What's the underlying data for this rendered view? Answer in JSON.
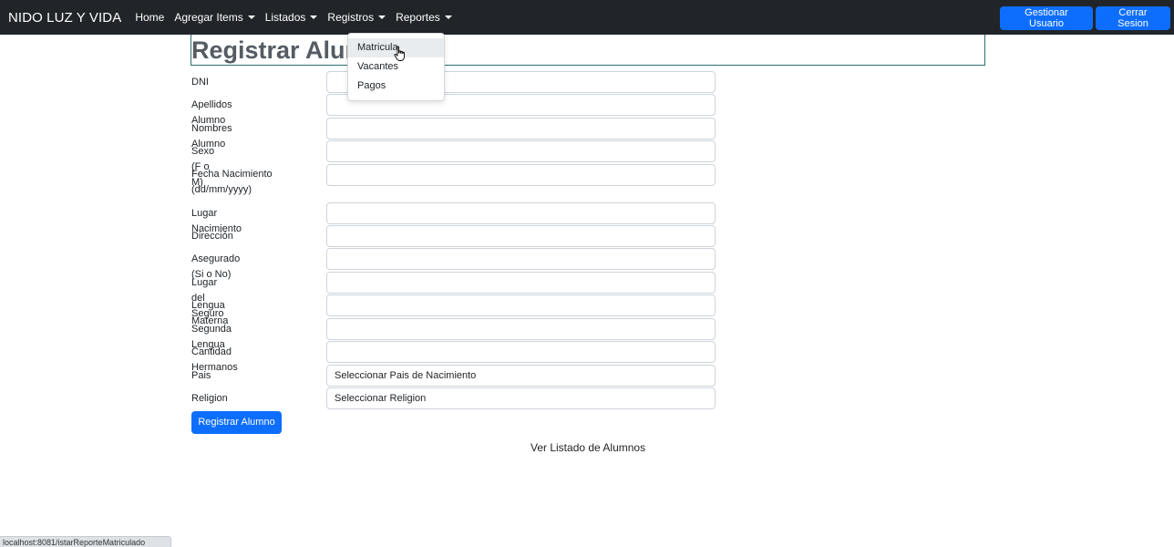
{
  "navbar": {
    "brand": "NIDO LUZ Y VIDA",
    "links": [
      {
        "label": "Home"
      },
      {
        "label": "Agregar Items"
      },
      {
        "label": "Listados"
      },
      {
        "label": "Registros"
      },
      {
        "label": "Reportes"
      }
    ],
    "manage_user_label": "Gestionar Usuario",
    "logout_label": "Cerrar Sesion"
  },
  "reportes_menu": {
    "items": [
      {
        "label": "Matricula"
      },
      {
        "label": "Vacantes"
      },
      {
        "label": "Pagos"
      }
    ]
  },
  "page": {
    "title": "Registrar Alumno"
  },
  "form": {
    "fields": [
      {
        "label": "DNI",
        "value": ""
      },
      {
        "label": "Apellidos Alumno",
        "value": ""
      },
      {
        "label": "Nombres Alumno",
        "value": ""
      },
      {
        "label": "Sexo (F o M)",
        "value": ""
      },
      {
        "label": "Fecha Nacimiento (dd/mm/yyyy)",
        "value": ""
      },
      {
        "label": "Lugar Nacimiento",
        "value": ""
      },
      {
        "label": "Dirección",
        "value": ""
      },
      {
        "label": "Asegurado (Si o No)",
        "value": ""
      },
      {
        "label": "Lugar del Seguro",
        "value": ""
      },
      {
        "label": "Lengua Materna",
        "value": ""
      },
      {
        "label": "Segunda Lengua",
        "value": ""
      },
      {
        "label": "Cantidad Hermanos",
        "value": ""
      }
    ],
    "selects": [
      {
        "label": "Pais",
        "value": "Seleccionar Pais de Nacimiento"
      },
      {
        "label": "Religion",
        "value": "Seleccionar Religion"
      }
    ],
    "submit_label": "Registrar Alumno",
    "list_link": "Ver Listado de Alumnos"
  },
  "statusbar": {
    "url": "localhost:8081/istarReporteMatriculado"
  }
}
